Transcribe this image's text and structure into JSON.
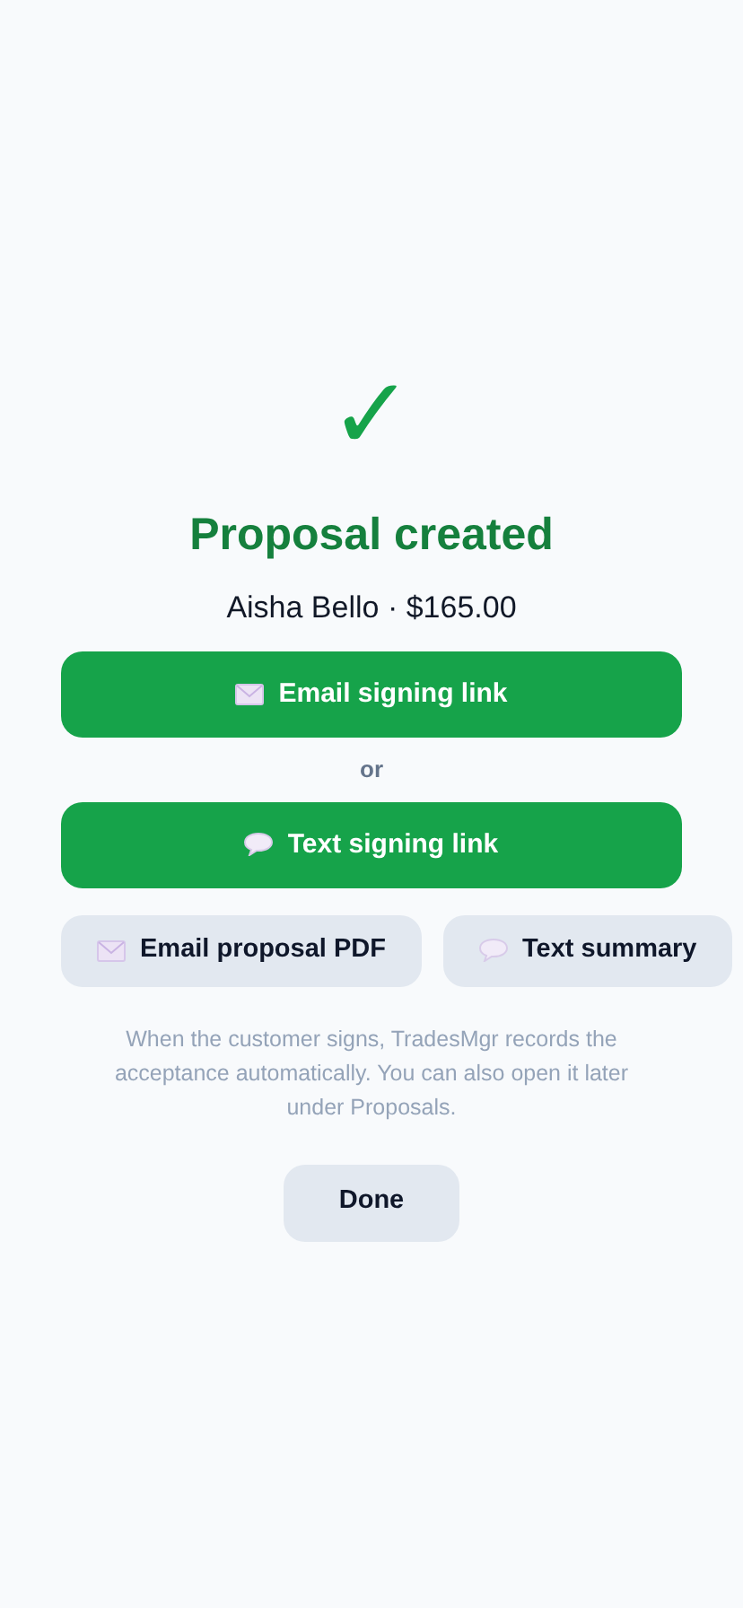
{
  "check_mark": "✓",
  "title": "Proposal created",
  "subtitle": "Aisha Bello · $165.00",
  "primary_actions": [
    {
      "label": "Email signing link",
      "kind": "email"
    },
    {
      "label": "Text signing link",
      "kind": "text"
    }
  ],
  "separator": "or",
  "secondary_actions": [
    {
      "label": "Email proposal PDF",
      "kind": "email"
    },
    {
      "label": "Text summary",
      "kind": "text"
    }
  ],
  "note": "When the customer signs, TradesMgr records the acceptance automatically. You can also open it later under Proposals.",
  "done_button": "Done"
}
